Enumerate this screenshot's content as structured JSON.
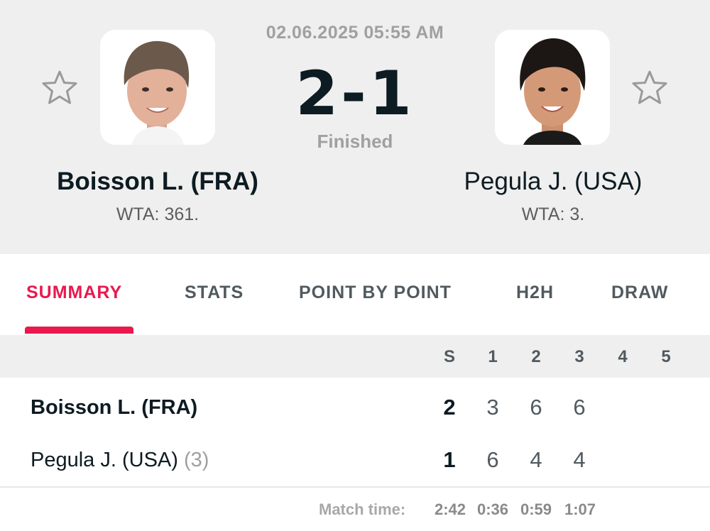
{
  "match": {
    "datetime": "02.06.2025 05:55 AM",
    "score": "2-1",
    "status": "Finished"
  },
  "players": [
    {
      "name": "Boisson L. (FRA)",
      "rank": "WTA: 361."
    },
    {
      "name": "Pegula J. (USA)",
      "rank": "WTA: 3."
    }
  ],
  "tabs": [
    {
      "label": "SUMMARY",
      "active": true
    },
    {
      "label": "STATS"
    },
    {
      "label": "POINT BY POINT"
    },
    {
      "label": "H2H"
    },
    {
      "label": "DRAW"
    }
  ],
  "table": {
    "headers": [
      "S",
      "1",
      "2",
      "3",
      "4",
      "5"
    ],
    "rows": [
      {
        "name": "Boisson L. (FRA)",
        "seed": "",
        "sets": "2",
        "games": [
          "3",
          "6",
          "6"
        ]
      },
      {
        "name": "Pegula J. (USA)",
        "seed": "(3)",
        "sets": "1",
        "games": [
          "6",
          "4",
          "4"
        ]
      }
    ],
    "match_time_label": "Match time:",
    "match_times": [
      "2:42",
      "0:36",
      "0:59",
      "1:07"
    ]
  },
  "colors": {
    "accent": "#e8194e",
    "text_dark": "#0d1b22",
    "header_bg": "#efefef"
  }
}
